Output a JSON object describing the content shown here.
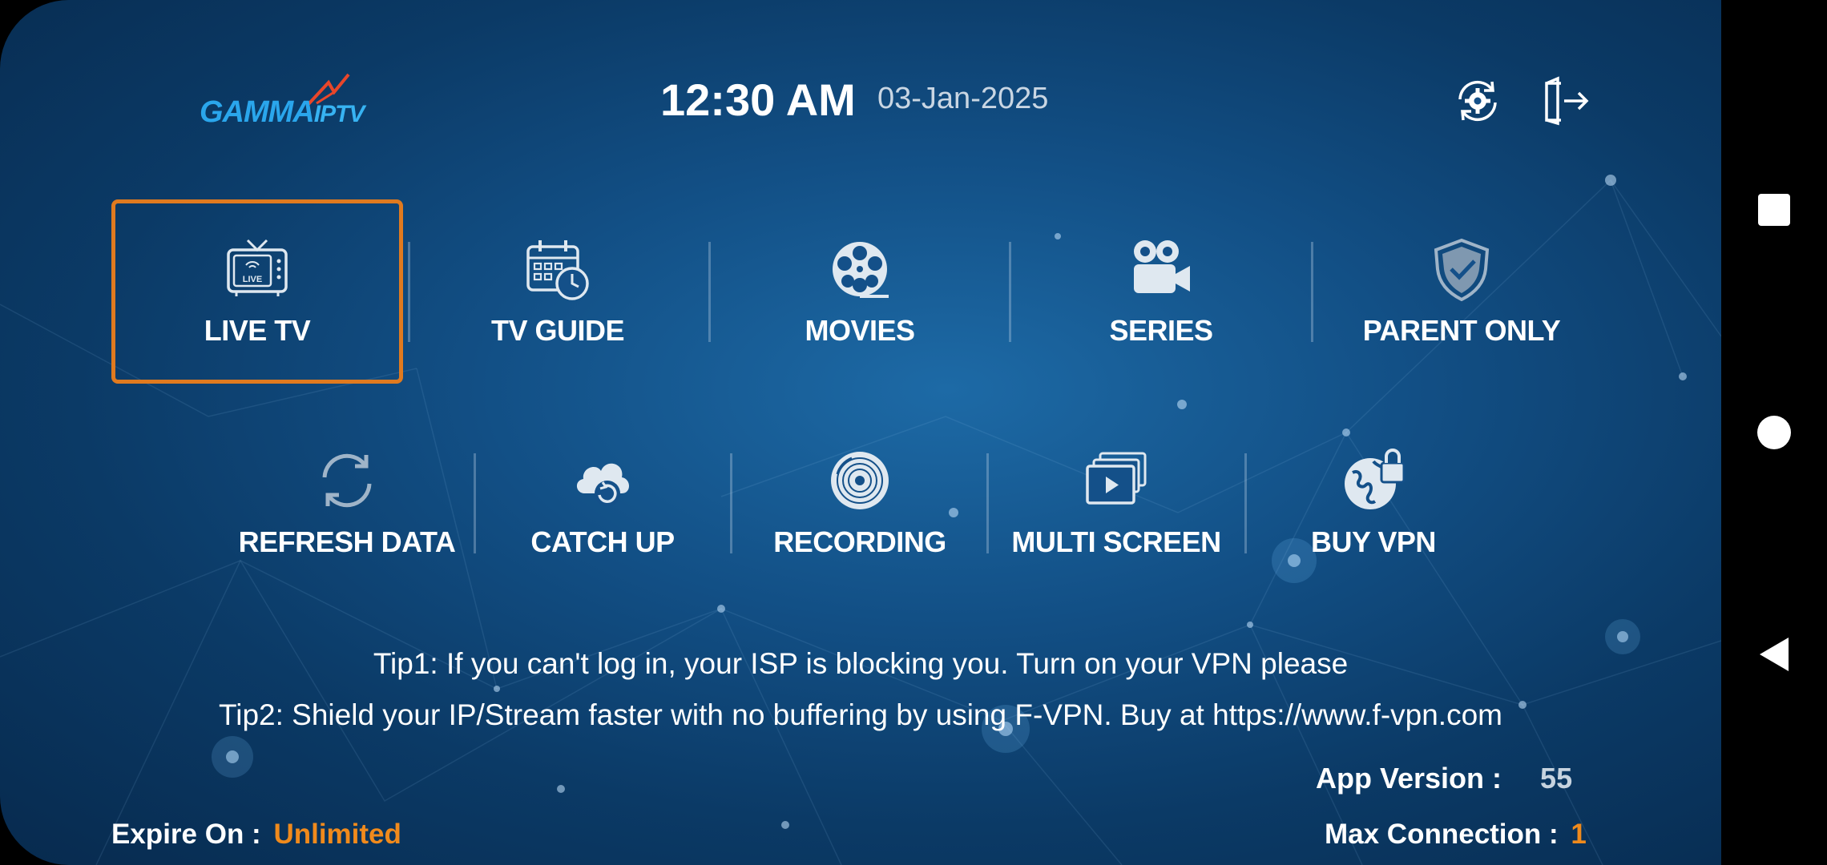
{
  "header": {
    "logo_text_primary": "GAMMA",
    "logo_text_secondary": "IPTV",
    "time": "12:30 AM",
    "date": "03-Jan-2025",
    "settings_icon": "settings-refresh-gear-icon",
    "logout_icon": "logout-door-icon"
  },
  "menu_row1": [
    {
      "label": "LIVE TV",
      "icon": "live-tv-icon",
      "focused": true
    },
    {
      "label": "TV GUIDE",
      "icon": "calendar-clock-icon"
    },
    {
      "label": "MOVIES",
      "icon": "film-reel-icon"
    },
    {
      "label": "SERIES",
      "icon": "video-camera-icon"
    },
    {
      "label": "PARENT ONLY",
      "icon": "shield-check-icon"
    }
  ],
  "menu_row2": [
    {
      "label": "REFRESH DATA",
      "icon": "refresh-icon"
    },
    {
      "label": "CATCH UP",
      "icon": "cloud-refresh-icon"
    },
    {
      "label": "RECORDING",
      "icon": "vinyl-disc-icon"
    },
    {
      "label": "MULTI SCREEN",
      "icon": "multi-screen-icon"
    },
    {
      "label": "BUY VPN",
      "icon": "globe-lock-icon"
    }
  ],
  "tips": {
    "tip1": "Tip1: If you can't log in, your ISP is blocking you. Turn on your VPN please",
    "tip2": "Tip2: Shield your IP/Stream faster with no buffering by using F-VPN. Buy at https://www.f-vpn.com"
  },
  "footer": {
    "app_version_label": "App Version :",
    "app_version_value": "55",
    "expire_label": "Expire On :",
    "expire_value": "Unlimited",
    "max_connection_label": "Max Connection :",
    "max_connection_value": "1"
  },
  "colors": {
    "focus_border": "#e07a1f",
    "accent_orange": "#f08a1c",
    "background": "#124f85"
  },
  "system_nav": {
    "recents_icon": "square-recents-icon",
    "home_icon": "circle-home-icon",
    "back_icon": "triangle-back-icon"
  }
}
